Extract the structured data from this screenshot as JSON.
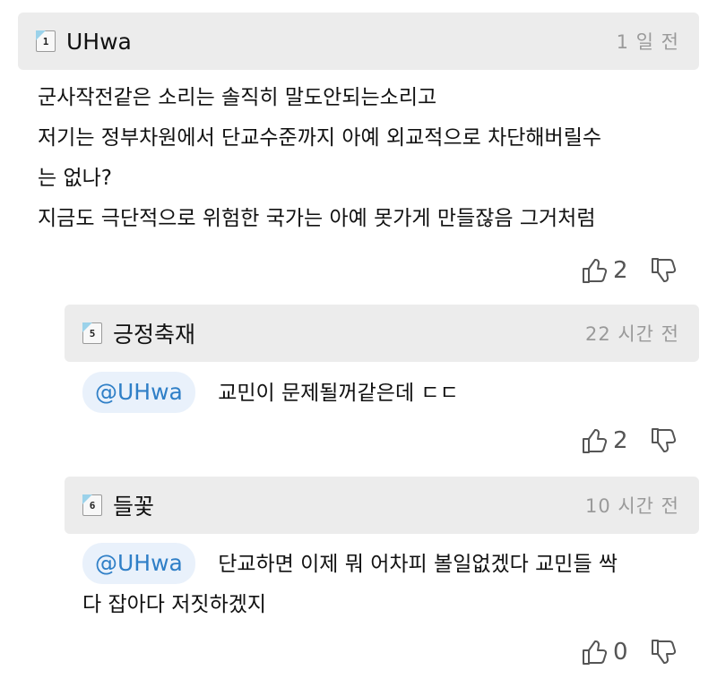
{
  "comments": [
    {
      "level_badge": "1",
      "username": "UHwa",
      "time": "1 일 전",
      "lines": [
        "군사작전같은 소리는 솔직히 말도안되는소리고",
        "저기는 정부차원에서 단교수준까지 아예 외교적으로 차단해버릴수",
        "는 없나?",
        "지금도 극단적으로 위험한 국가는 아예 못가게 만들잖음 그거처럼"
      ],
      "likes": "2"
    },
    {
      "level_badge": "5",
      "username": "긍정축재",
      "time": "22 시간 전",
      "mention": "@UHwa",
      "lines": [
        "교민이 문제될꺼같은데 ㄷㄷ"
      ],
      "likes": "2"
    },
    {
      "level_badge": "6",
      "username": "들꽃",
      "time": "10 시간 전",
      "mention": "@UHwa",
      "lines": [
        "단교하면 이제 뭐 어차피 볼일없겠다 교민들 싹",
        "다 잡아다 저짓하겠지"
      ],
      "likes": "0"
    }
  ],
  "icons": {
    "like": "thumbs-up-outline-icon",
    "dislike": "thumbs-down-outline-icon"
  },
  "colors": {
    "header_bg": "#ececec",
    "mention_text": "#2f7fc7",
    "mention_bg": "#e9f1fb",
    "time_text": "#9a9a9a"
  }
}
